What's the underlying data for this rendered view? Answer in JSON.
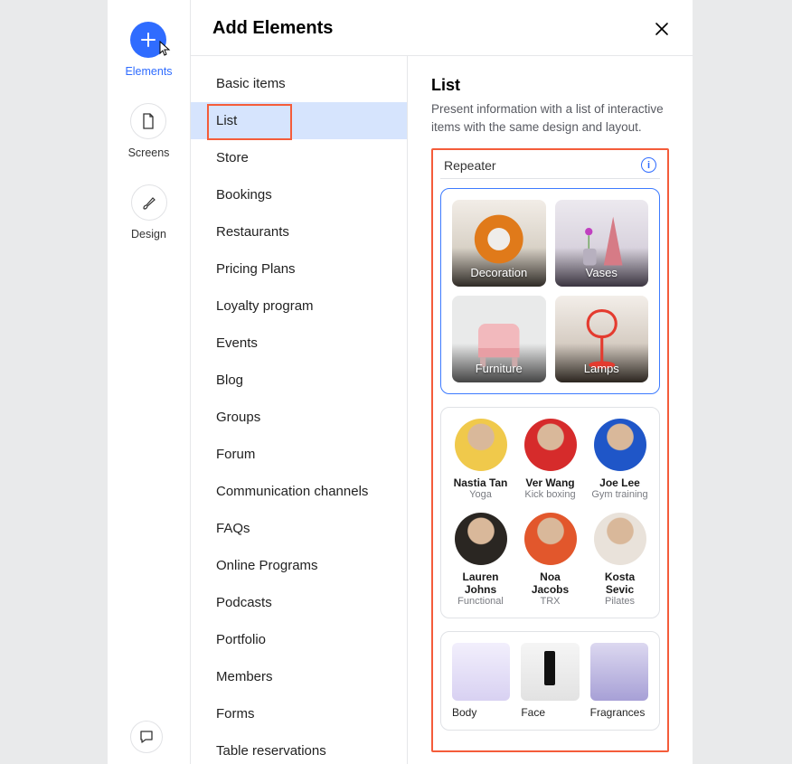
{
  "vnav": {
    "items": [
      {
        "label": "Elements",
        "icon": "plus",
        "active": true
      },
      {
        "label": "Screens",
        "icon": "page"
      },
      {
        "label": "Design",
        "icon": "brush"
      }
    ]
  },
  "panel": {
    "title": "Add Elements"
  },
  "categories": [
    "Basic items",
    "List",
    "Store",
    "Bookings",
    "Restaurants",
    "Pricing Plans",
    "Loyalty program",
    "Events",
    "Blog",
    "Groups",
    "Forum",
    "Communication channels",
    "FAQs",
    "Online Programs",
    "Podcasts",
    "Portfolio",
    "Members",
    "Forms",
    "Table reservations"
  ],
  "selected_category_index": 1,
  "detail": {
    "title": "List",
    "description": "Present information with a list of interactive items with the same design and layout.",
    "section_label": "Repeater",
    "tiles": [
      {
        "label": "Decoration"
      },
      {
        "label": "Vases"
      },
      {
        "label": "Furniture"
      },
      {
        "label": "Lamps"
      }
    ],
    "people": [
      {
        "name": "Nastia Tan",
        "role": "Yoga",
        "bg": "#f0c94b"
      },
      {
        "name": "Ver Wang",
        "role": "Kick boxing",
        "bg": "#d62b2b"
      },
      {
        "name": "Joe Lee",
        "role": "Gym training",
        "bg": "#1f56c8"
      },
      {
        "name": "Lauren Johns",
        "role": "Functional",
        "bg": "#2a2622"
      },
      {
        "name": "Noa Jacobs",
        "role": "TRX",
        "bg": "#e2572c"
      },
      {
        "name": "Kosta Sevic",
        "role": "Pilates",
        "bg": "#e9e2da"
      }
    ],
    "products": [
      {
        "label": "Body"
      },
      {
        "label": "Face"
      },
      {
        "label": "Fragrances"
      }
    ]
  }
}
